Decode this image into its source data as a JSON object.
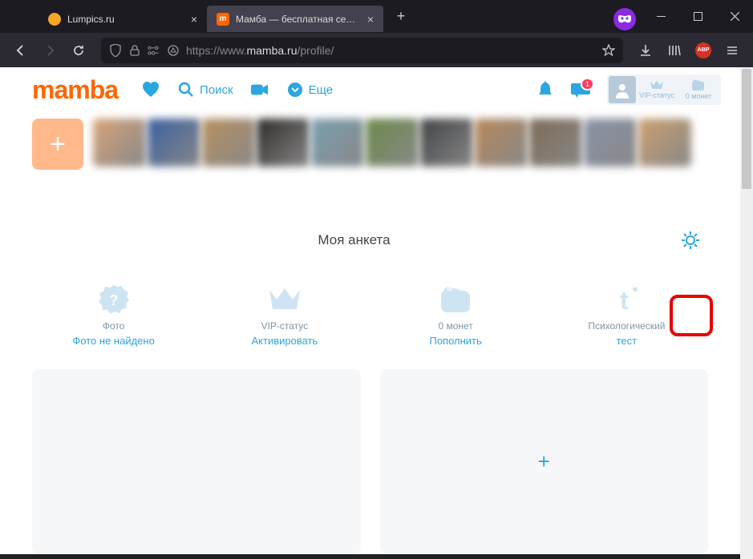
{
  "browser": {
    "tabs": [
      {
        "title": "Lumpics.ru",
        "favicon_color": "#f5a623"
      },
      {
        "title": "Мамба — бесплатная сеть зна",
        "favicon_color": "#ff6600"
      }
    ],
    "url_prefix": "https://www.",
    "url_host": "mamba.ru",
    "url_path": "/profile/",
    "abp_label": "ABP"
  },
  "site": {
    "logo": "mamba",
    "nav": {
      "search": "Поиск",
      "more": "Еще"
    },
    "notifications_badge": "1",
    "user_chips": {
      "vip": "VIP-статус",
      "coins": "0 монет"
    }
  },
  "profile": {
    "title": "Моя анкета",
    "cards": {
      "photo": {
        "label": "Фото",
        "action": "Фото не найдено"
      },
      "vip": {
        "label": "VIP-статус",
        "action": "Активировать"
      },
      "coins": {
        "label": "0 монет",
        "action": "Пополнить"
      },
      "test": {
        "label": "Психологический",
        "action": "тест"
      }
    }
  },
  "thumbs": [
    "#d9a47a",
    "#3a5fa0",
    "#b89060",
    "#2e2a28",
    "#7a9fb0",
    "#6b8a4a",
    "#404244",
    "#b8885a",
    "#7d6a55",
    "#8a92a8",
    "#cba070"
  ]
}
